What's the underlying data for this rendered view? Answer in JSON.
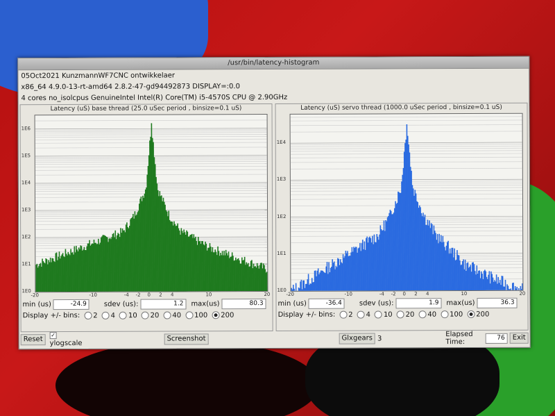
{
  "window": {
    "title": "/usr/bin/latency-histogram"
  },
  "info": {
    "line1": "05Oct2021 KunzmannWF7CNC ontwikkelaer",
    "line2": "x86_64  4.9.0-13-rt-amd64  2.8.2-47-gd94492873  DISPLAY=:0.0",
    "line3": "4 cores  no_isolcpus   GenuineIntel  Intel(R) Core(TM) i5-4570S CPU @ 2.90GHz"
  },
  "base": {
    "title": "Latency (uS) base thread (25.0 uSec period , binsize=0.1 uS)",
    "color": "#1f7a1f",
    "ytick_labels": [
      "1E6",
      "1E5",
      "1E4",
      "1E3",
      "1E2",
      "1E1",
      "1E0"
    ],
    "xtick_labels": [
      "-20",
      "-10",
      "-4",
      "-2",
      "0",
      "2",
      "4",
      "10",
      "20"
    ],
    "min_label": "min (us)",
    "min": "-24.9",
    "sdev_label": "sdev (us):",
    "sdev": "1.2",
    "max_label": "max(us)",
    "max": "80.3"
  },
  "servo": {
    "title": "Latency (uS) servo thread (1000.0 uSec period , binsize=0.1 uS)",
    "color": "#2b6be0",
    "ytick_labels": [
      "1E4",
      "1E3",
      "1E2",
      "1E1",
      "1E0"
    ],
    "xtick_labels": [
      "-20",
      "-10",
      "-4",
      "-2",
      "0",
      "2",
      "4",
      "10",
      "20"
    ],
    "min_label": "min (us)",
    "min": "-36.4",
    "sdev_label": "sdev (us):",
    "sdev": "1.9",
    "max_label": "max(us)",
    "max": "36.3"
  },
  "bins": {
    "label": "Display +/- bins:",
    "options": [
      "2",
      "4",
      "10",
      "20",
      "40",
      "100",
      "200"
    ],
    "selected": "200"
  },
  "bottom": {
    "reset": "Reset",
    "ylogscale": "ylogscale",
    "screenshot": "Screenshot",
    "glxgears": "Glxgears",
    "glxgears_value": "3",
    "elapsed_label": "Elapsed Time:",
    "elapsed_value": "76",
    "exit": "Exit"
  },
  "chart_data": [
    {
      "type": "bar",
      "title": "Latency (uS) base thread (25.0 uSec period , binsize=0.1 uS)",
      "xlim": [
        -20,
        20
      ],
      "ylim_log10": [
        0,
        6
      ],
      "y_scale": "log",
      "color": "#1f7a1f",
      "peak_log10": 6.2,
      "x_log10_profile": [
        [
          -20,
          1.0
        ],
        [
          -15,
          1.4
        ],
        [
          -10,
          1.8
        ],
        [
          -5,
          2.2
        ],
        [
          -3,
          2.8
        ],
        [
          -1,
          3.8
        ],
        [
          0,
          6.2
        ],
        [
          1,
          3.8
        ],
        [
          3,
          2.8
        ],
        [
          5,
          2.2
        ],
        [
          10,
          1.6
        ],
        [
          15,
          1.2
        ],
        [
          20,
          0.8
        ]
      ],
      "ticks_x": [
        -20,
        -10,
        -4,
        -2,
        0,
        2,
        4,
        10,
        20
      ]
    },
    {
      "type": "bar",
      "title": "Latency (uS) servo thread (1000.0 uSec period , binsize=0.1 uS)",
      "xlim": [
        -20,
        20
      ],
      "ylim_log10": [
        0,
        4.5
      ],
      "y_scale": "log",
      "color": "#2b6be0",
      "peak_log10": 4.5,
      "x_log10_profile": [
        [
          -20,
          0.0
        ],
        [
          -15,
          0.5
        ],
        [
          -10,
          1.0
        ],
        [
          -5,
          1.5
        ],
        [
          -3,
          2.0
        ],
        [
          -1,
          2.8
        ],
        [
          0,
          4.5
        ],
        [
          1,
          2.8
        ],
        [
          3,
          2.0
        ],
        [
          5,
          1.5
        ],
        [
          10,
          0.7
        ],
        [
          15,
          0.3
        ],
        [
          20,
          0.0
        ]
      ],
      "ticks_x": [
        -20,
        -10,
        -4,
        -2,
        0,
        2,
        4,
        10,
        20
      ]
    }
  ]
}
